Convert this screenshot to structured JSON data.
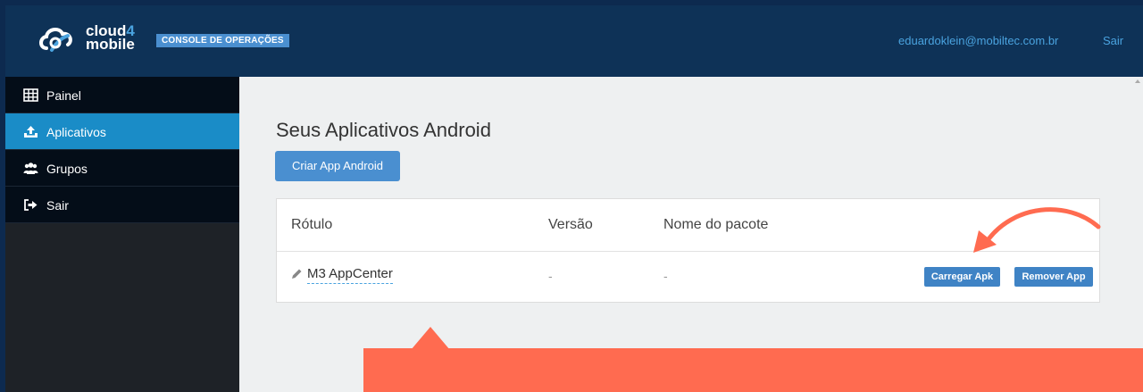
{
  "header": {
    "logo_text_line1": "cloud",
    "logo_text_four": "4",
    "logo_text_line2": "mobile",
    "console_badge": "CONSOLE DE OPERAÇÕES",
    "user_email": "eduardoklein@mobiltec.com.br",
    "logout_label": "Sair"
  },
  "sidebar": {
    "items": [
      {
        "label": "Painel",
        "icon": "table-grid-icon",
        "active": false
      },
      {
        "label": "Aplicativos",
        "icon": "upload-icon",
        "active": true
      },
      {
        "label": "Grupos",
        "icon": "users-icon",
        "active": false
      },
      {
        "label": "Sair",
        "icon": "sign-out-icon",
        "active": false
      }
    ]
  },
  "main": {
    "title": "Seus Aplicativos Android",
    "create_button_label": "Criar App Android",
    "table": {
      "headers": [
        "Rótulo",
        "Versão",
        "Nome do pacote"
      ],
      "rows": [
        {
          "label": "M3 AppCenter",
          "version": "-",
          "package": "-",
          "upload_button": "Carregar Apk",
          "remove_button": "Remover App"
        }
      ]
    }
  },
  "colors": {
    "header_bg": "#0e3257",
    "sidebar_active": "#1a8cc7",
    "button_blue": "#4a8fd0",
    "annotation_coral": "#ff6b50"
  }
}
